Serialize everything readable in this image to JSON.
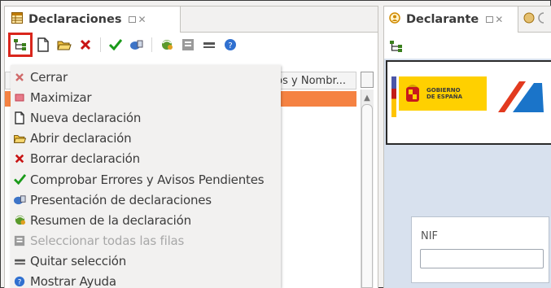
{
  "left_view": {
    "tab_title": "Declaraciones",
    "column_header": "os y Nombr..."
  },
  "menu": {
    "items": [
      {
        "label": "Cerrar",
        "icon": "close-x-icon",
        "disabled": false
      },
      {
        "label": "Maximizar",
        "icon": "maximize-icon",
        "disabled": false
      },
      {
        "label": "Nueva declaración",
        "icon": "new-document-icon",
        "disabled": false
      },
      {
        "label": "Abrir declaración",
        "icon": "open-folder-icon",
        "disabled": false
      },
      {
        "label": "Borrar declaración",
        "icon": "delete-x-icon",
        "disabled": false
      },
      {
        "label": "Comprobar Errores y Avisos Pendientes",
        "icon": "checkmark-icon",
        "disabled": false
      },
      {
        "label": "Presentación de declaraciones",
        "icon": "present-icon",
        "disabled": false
      },
      {
        "label": "Resumen de la declaración",
        "icon": "summary-icon",
        "disabled": false
      },
      {
        "label": "Seleccionar todas las filas",
        "icon": "select-all-icon",
        "disabled": true
      },
      {
        "label": "Quitar selección",
        "icon": "deselect-icon",
        "disabled": false
      },
      {
        "label": "Mostrar Ayuda",
        "icon": "help-icon",
        "disabled": false
      }
    ]
  },
  "right_view": {
    "tab_title": "Declarante",
    "banner_text_line1": "GOBIERNO",
    "banner_text_line2": "DE ESPAÑA",
    "nif_label": "NIF",
    "nif_value": ""
  },
  "colors": {
    "selected_row": "#f58242",
    "highlight_border": "#d9261c",
    "content_bg": "#d8e1ee",
    "gobierno_yellow": "#ffd000"
  }
}
